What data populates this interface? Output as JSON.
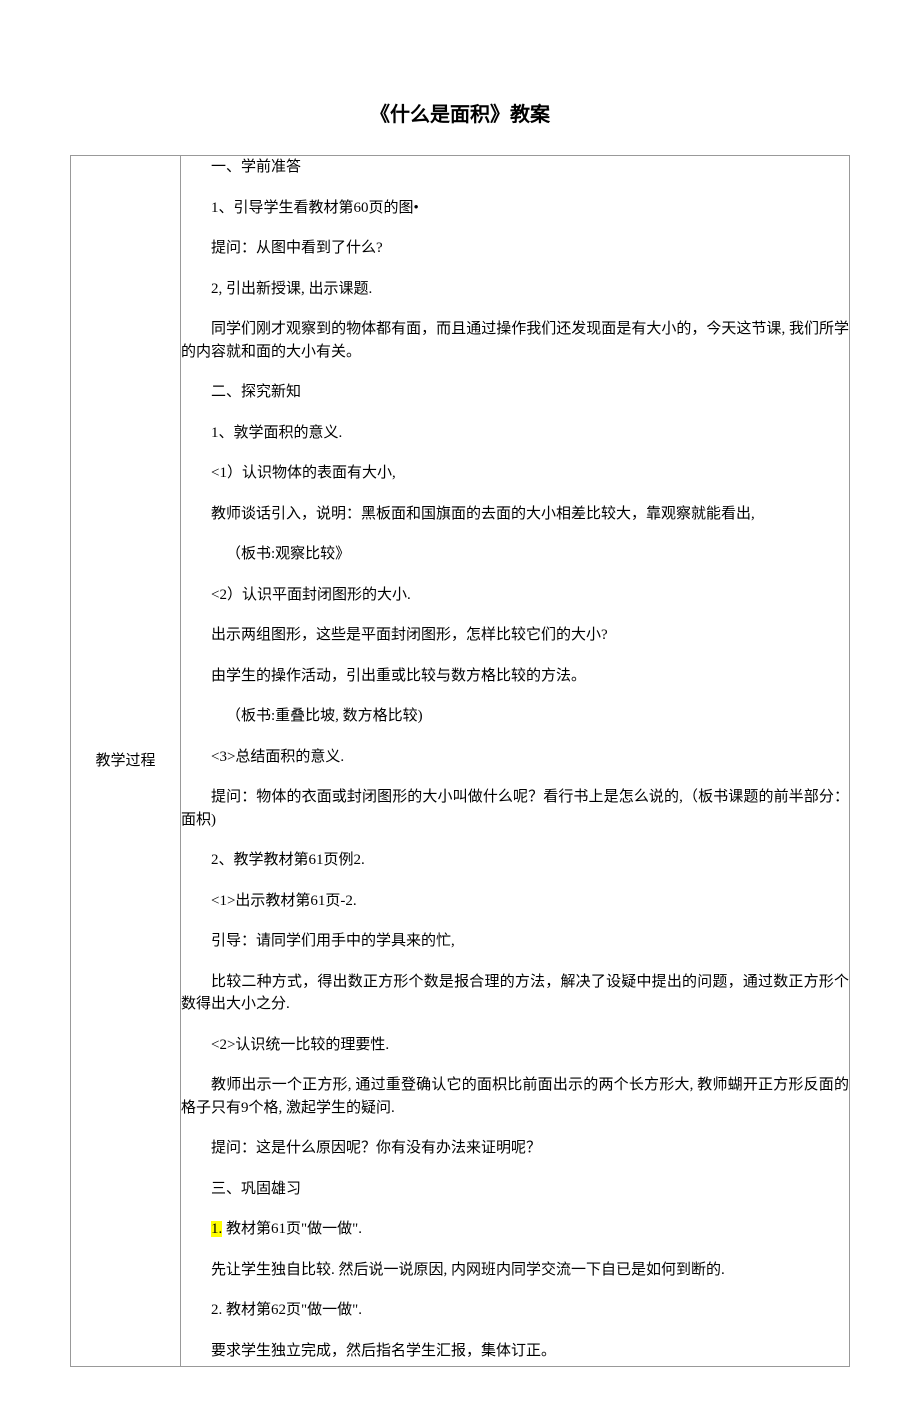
{
  "title": "《什么是面积》教案",
  "label": "教学过程",
  "content": {
    "p1": "一、学前准答",
    "p2": "1、引导学生看教材第60页的图•",
    "p3": "提问：从图中看到了什么?",
    "p4": "2, 引出新授课, 出示课题.",
    "p5": "同学们刚才观察到的物体都有面，而且通过操作我们还发现面是有大小的，今天这节课, 我们所学的内容就和面的大小有关。",
    "p6": "二、探究新知",
    "p7": "1、敦学面积的意义.",
    "p8": "<1）认识物体的表面有大小,",
    "p9": "教师谈话引入，说明：黑板面和国旗面的去面的大小相差比较大，靠观察就能看出,",
    "p10": "（板书:观察比较》",
    "p11": "<2）认识平面封闭图形的大小.",
    "p12": "出示两组图形，这些是平面封闭图形，怎样比较它们的大小?",
    "p13": "由学生的操作活动，引出重或比较与数方格比较的方法。",
    "p14": "（板书:重叠比坡, 数方格比较)",
    "p15": "<3>总结面积的意义.",
    "p16": "提问：物体的衣面或封闭图形的大小叫做什么呢？看行书上是怎么说的,（板书课题的前半部分：面枳)",
    "p17": "2、教学教材第61页例2.",
    "p18": "<1>出示教材第61页-2.",
    "p19": "引导：请同学们用手中的学具来的忙,",
    "p20": "比较二种方式，得出数正方形个数是报合理的方法，解决了设疑中提出的问题，通过数正方形个数得出大小之分.",
    "p21": "<2>认识统一比较的理要性.",
    "p22": "教师出示一个正方形, 通过重登确认它的面枳比前面出示的两个长方形大, 教师蝴开正方形反面的格子只有9个格, 激起学生的疑问.",
    "p23": "提问：这是什么原因呢？你有没有办法来证明呢？",
    "p24": "三、巩固雄习",
    "p25_prefix": "1.",
    "p25_rest": " 教材第61页\"做一做\".",
    "p26": "先让学生独自比较. 然后说一说原因, 内网班内同学交流一下自已是如何到断的.",
    "p27": "2. 教材第62页\"做一做\".",
    "p28": "要求学生独立完成，然后指名学生汇报，集体订正。"
  }
}
